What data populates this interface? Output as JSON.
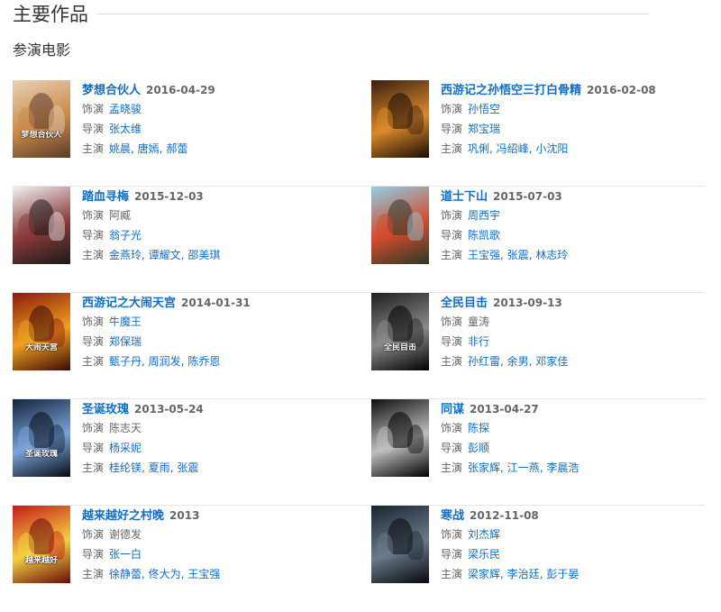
{
  "section_title": "主要作品",
  "sub_title": "参演电影",
  "labels": {
    "role": "饰演",
    "director": "导演",
    "cast": "主演"
  },
  "films": [
    {
      "title": "梦想合伙人",
      "date": "2016-04-29",
      "role": "孟晓骏",
      "role_link": true,
      "director": "张太维",
      "cast": [
        "姚晨",
        "唐嫣",
        "郝蕾"
      ],
      "poster_text": "梦想合伙人",
      "poster": {
        "bg": "#e8d2b4",
        "accent": "#c98a4a",
        "dark": "#5a3a2a"
      }
    },
    {
      "title": "西游记之孙悟空三打白骨精",
      "date": "2016-02-08",
      "role": "孙悟空",
      "role_link": true,
      "director": "郑宝瑞",
      "cast": [
        "巩俐",
        "冯绍峰",
        "小沈阳"
      ],
      "poster_text": "",
      "poster": {
        "bg": "#3a1e12",
        "accent": "#d98a2a",
        "dark": "#1a0c06"
      }
    },
    {
      "title": "踏血寻梅",
      "date": "2015-12-03",
      "role": "阿臧",
      "role_link": false,
      "director": "翁子光",
      "cast": [
        "金燕玲",
        "谭耀文",
        "邵美琪"
      ],
      "poster_text": "",
      "poster": {
        "bg": "#f2f2f2",
        "accent": "#8a3a3a",
        "dark": "#1a1a1a"
      }
    },
    {
      "title": "道士下山",
      "date": "2015-07-03",
      "role": "周西宇",
      "role_link": true,
      "director": "陈凯歌",
      "cast": [
        "王宝强",
        "张震",
        "林志玲"
      ],
      "poster_text": "",
      "poster": {
        "bg": "#8ed0e8",
        "accent": "#d44a2a",
        "dark": "#2a3a2a"
      }
    },
    {
      "title": "西游记之大闹天宫",
      "date": "2014-01-31",
      "role": "牛魔王",
      "role_link": true,
      "director": "郑保瑞",
      "cast": [
        "甄子丹",
        "周润发",
        "陈乔恩"
      ],
      "poster_text": "大闹天宫",
      "poster": {
        "bg": "#8a1a0e",
        "accent": "#f0a020",
        "dark": "#3a0a06"
      }
    },
    {
      "title": "全民目击",
      "date": "2013-09-13",
      "role": "童涛",
      "role_link": false,
      "director": "非行",
      "cast": [
        "孙红雷",
        "余男",
        "邓家佳"
      ],
      "poster_text": "全民目击",
      "poster": {
        "bg": "#1e1e1e",
        "accent": "#8a8a8a",
        "dark": "#000000"
      }
    },
    {
      "title": "圣诞玫瑰",
      "date": "2013-05-24",
      "role": "陈志天",
      "role_link": false,
      "director": "杨采妮",
      "cast": [
        "桂纶镁",
        "夏雨",
        "张震"
      ],
      "poster_text": "圣诞玫瑰",
      "poster": {
        "bg": "#12243e",
        "accent": "#7aa4d8",
        "dark": "#050a14"
      }
    },
    {
      "title": "同谋",
      "date": "2013-04-27",
      "role": "陈探",
      "role_link": true,
      "director": "彭顺",
      "cast": [
        "张家辉",
        "江一燕",
        "李晨浩"
      ],
      "poster_text": "",
      "poster": {
        "bg": "#0e0e0e",
        "accent": "#bfbfbf",
        "dark": "#000000"
      }
    },
    {
      "title": "越来越好之村晚",
      "date": "2013",
      "role": "谢德发",
      "role_link": false,
      "director": "张一白",
      "cast": [
        "徐静蕾",
        "佟大为",
        "王宝强"
      ],
      "poster_text": "越来越好",
      "poster": {
        "bg": "#c41a1a",
        "accent": "#f4d040",
        "dark": "#6a0a0a"
      }
    },
    {
      "title": "寒战",
      "date": "2012-11-08",
      "role": "刘杰辉",
      "role_link": true,
      "director": "梁乐民",
      "cast": [
        "梁家辉",
        "李治廷",
        "彭于晏"
      ],
      "poster_text": "",
      "poster": {
        "bg": "#1a2430",
        "accent": "#6a7a8a",
        "dark": "#05080c"
      }
    }
  ]
}
